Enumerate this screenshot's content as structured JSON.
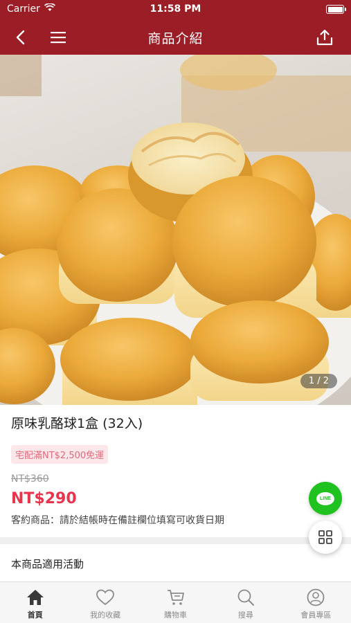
{
  "status_bar": {
    "carrier": "Carrier",
    "time": "11:58 PM"
  },
  "header": {
    "title": "商品介紹",
    "back_icon": "chevron-left-icon",
    "menu_icon": "hamburger-icon",
    "share_icon": "share-upload-icon",
    "color": "#9b1d25"
  },
  "gallery": {
    "pager": "1 / 2"
  },
  "product": {
    "title": "原味乳酪球1盒 (32入)",
    "shipping_tag": "宅配滿NT$2,500免運",
    "original_price": "NT$360",
    "price": "NT$290",
    "note": "客約商品：請於結帳時在備註欄位填寫可收貨日期",
    "price_color": "#e8344d"
  },
  "section": {
    "activity_title": "本商品適用活動"
  },
  "fab": {
    "line_label": "LINE",
    "line_color": "#1fc21f"
  },
  "tabbar": {
    "items": [
      {
        "label": "首頁",
        "icon": "home-icon",
        "active": true
      },
      {
        "label": "我的收藏",
        "icon": "heart-icon",
        "active": false
      },
      {
        "label": "購物車",
        "icon": "cart-icon",
        "active": false
      },
      {
        "label": "搜尋",
        "icon": "search-icon",
        "active": false
      },
      {
        "label": "會員專區",
        "icon": "user-icon",
        "active": false
      }
    ]
  }
}
